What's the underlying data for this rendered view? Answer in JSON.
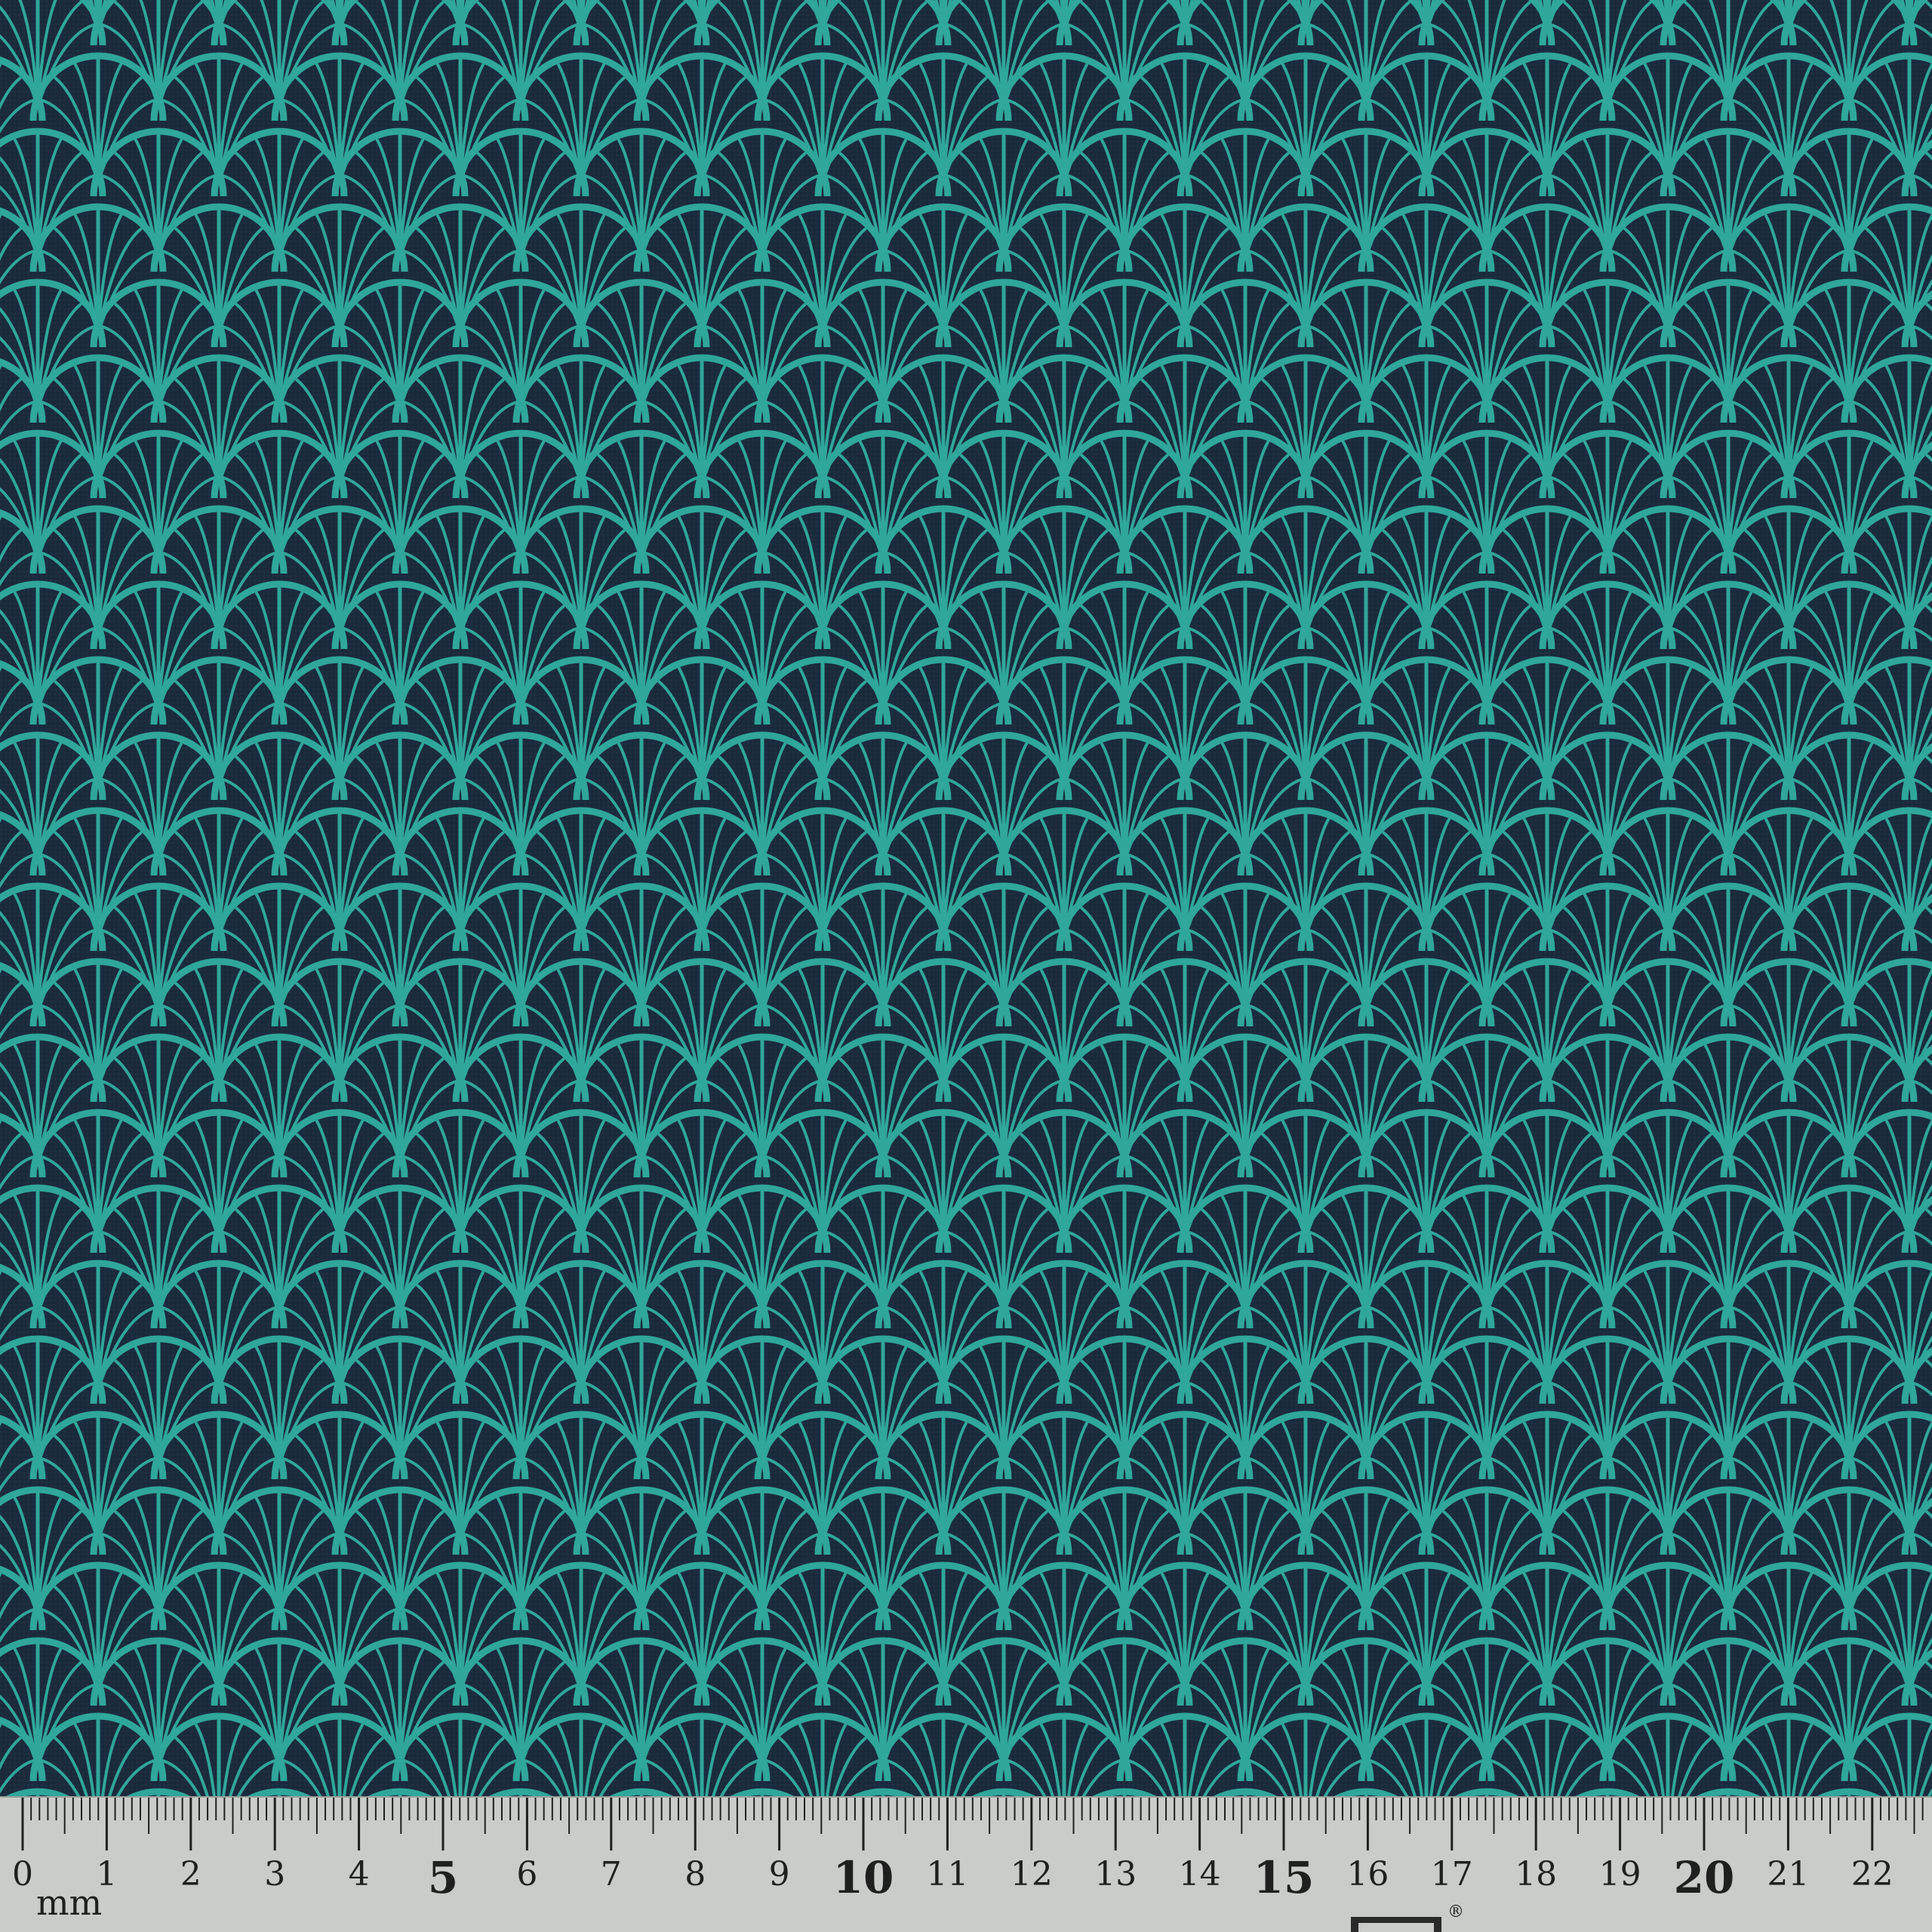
{
  "colors": {
    "fabric_background": "#1b2b3c",
    "fabric_print": "#2fa79a",
    "ruler_background": "#c9ccc9",
    "ruler_ink": "#1f1f1f"
  },
  "ruler": {
    "unit_label": "mm",
    "numbers": [
      "0",
      "1",
      "2",
      "3",
      "4",
      "5",
      "6",
      "7",
      "8",
      "9",
      "10",
      "11",
      "12",
      "13",
      "14",
      "15",
      "16",
      "17",
      "18",
      "19",
      "20",
      "21",
      "22"
    ],
    "emphasized_numbers": [
      "5",
      "10",
      "15",
      "20"
    ],
    "registered_mark": "®"
  }
}
